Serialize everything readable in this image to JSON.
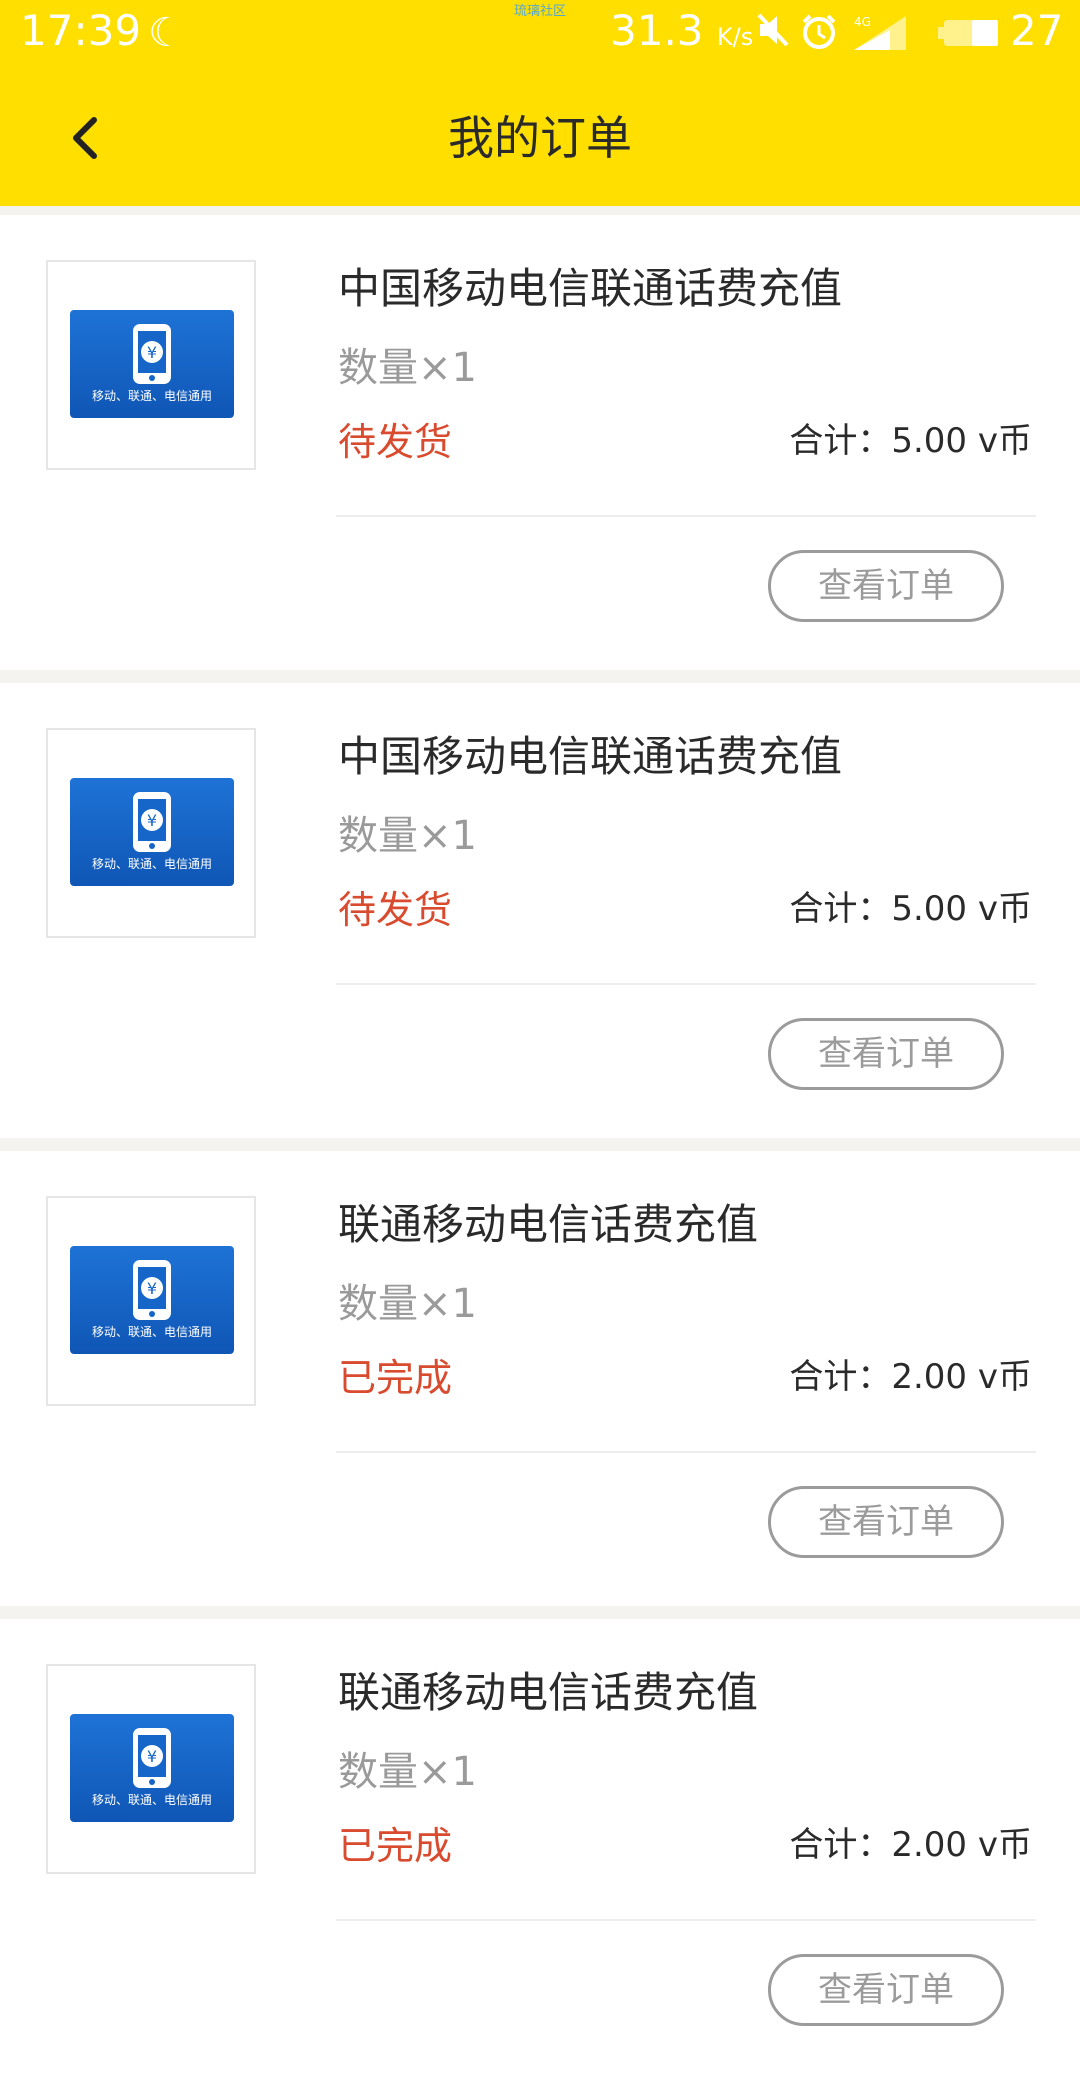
{
  "status_bar": {
    "time": "17:39",
    "watermark": "琉璃社区",
    "network_speed": "31.3",
    "speed_unit": "K/s",
    "signal_label": "4G",
    "battery": "27"
  },
  "header": {
    "title": "我的订单"
  },
  "orders": [
    {
      "name": "中国移动电信联通话费充值",
      "quantity": "数量×1",
      "status": "待发货",
      "total": "合计：5.00 v币",
      "image_text": "移动、联通、电信通用",
      "action": "查看订单"
    },
    {
      "name": "中国移动电信联通话费充值",
      "quantity": "数量×1",
      "status": "待发货",
      "total": "合计：5.00 v币",
      "image_text": "移动、联通、电信通用",
      "action": "查看订单"
    },
    {
      "name": "联通移动电信话费充值",
      "quantity": "数量×1",
      "status": "已完成",
      "total": "合计：2.00 v币",
      "image_text": "移动、联通、电信通用",
      "action": "查看订单"
    },
    {
      "name": "联通移动电信话费充值",
      "quantity": "数量×1",
      "status": "已完成",
      "total": "合计：2.00 v币",
      "image_text": "移动、联通、电信通用",
      "action": "查看订单"
    }
  ],
  "colors": {
    "header_bg": "#fedf00",
    "status_accent": "#d84b2f",
    "card_blue": "#1566c8"
  }
}
